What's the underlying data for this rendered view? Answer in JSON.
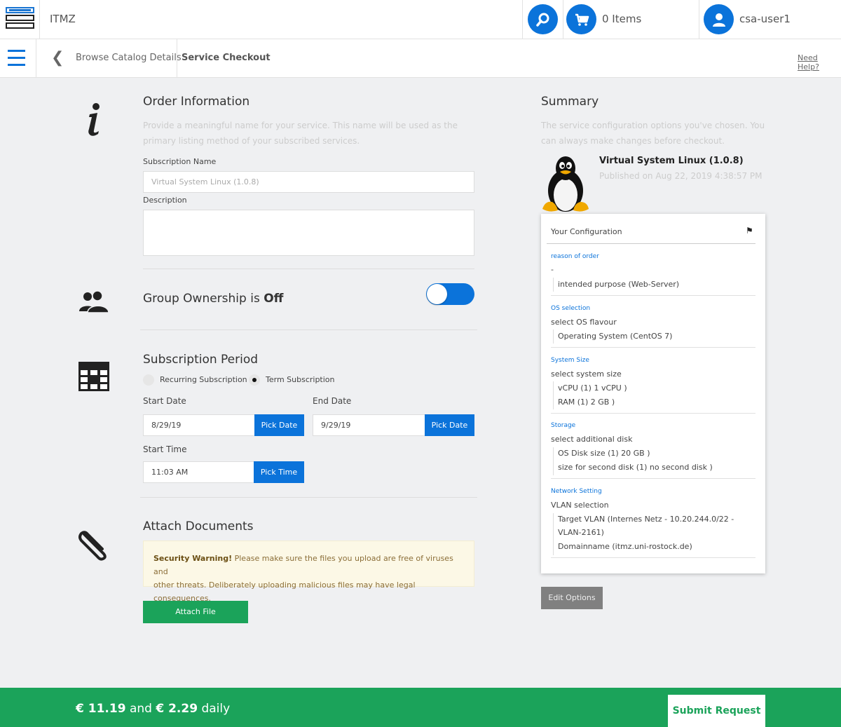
{
  "app": {
    "title": "ITMZ"
  },
  "header": {
    "cart_label": "0 Items",
    "user_name": "csa-user1"
  },
  "nav": {
    "breadcrumb": "Browse Catalog Details",
    "current": "Service Checkout",
    "help": "Need Help?"
  },
  "order": {
    "title": "Order Information",
    "description_line1": "Provide a meaningful name for your service. This name will be used as the",
    "description_line2": "primary listing method of your subscribed services.",
    "subscription_name_label": "Subscription Name",
    "subscription_name_placeholder": "Virtual System Linux (1.0.8)",
    "description_label": "Description"
  },
  "group": {
    "text": "Group Ownership is",
    "state": "Off"
  },
  "subscription": {
    "title": "Subscription Period",
    "options": [
      "Recurring Subscription",
      "Term Subscription"
    ],
    "selected": "Term Subscription",
    "start_date_label": "Start Date",
    "start_date": "8/29/19",
    "end_date_label": "End Date",
    "end_date": "9/29/19",
    "pick_date": "Pick Date",
    "start_time_label": "Start Time",
    "start_time": "11:03 AM",
    "pick_time": "Pick Time"
  },
  "attach": {
    "title": "Attach Documents",
    "warning_bold": "Security Warning!",
    "warning_line1": "Please make sure the files you upload are free of viruses and",
    "warning_line2": "other threats. Deliberately uploading malicious files may have legal consequences.",
    "button": "Attach File"
  },
  "summary": {
    "title": "Summary",
    "description_line1": "The service configuration options you've chosen. You",
    "description_line2": "can always make changes before checkout.",
    "product_name": "Virtual System Linux (1.0.8)",
    "product_published": "Published on Aug 22, 2019 4:38:57 PM",
    "config_title": "Your Configuration",
    "config": {
      "reason_cat": "reason of order",
      "reason_q": "-",
      "reason_a": "intended purpose (Web-Server)",
      "os_cat": "OS selection",
      "os_q": "select OS flavour",
      "os_a": "Operating System (CentOS 7)",
      "size_cat": "System Size",
      "size_q": "select system size",
      "size_a1": "vCPU (1) 1 vCPU )",
      "size_a2": "RAM (1) 2 GB )",
      "storage_cat": "Storage",
      "storage_q": "select additional disk",
      "storage_a1": "OS Disk size (1) 20 GB )",
      "storage_a2": "size for second disk (1) no second disk )",
      "net_cat": "Network Setting",
      "net_q": "VLAN selection",
      "net_a1": "Target VLAN (Internes Netz - 10.20.244.0/22 -",
      "net_a1b": "VLAN-2161)",
      "net_a2": "Domainname (itmz.uni-rostock.de)"
    },
    "edit_button": "Edit Options"
  },
  "footer": {
    "price_once": "€ 11.19",
    "and": "and",
    "price_daily": "€ 2.29",
    "daily": "daily",
    "submit": "Submit Request"
  },
  "colors": {
    "accent": "#0b73da",
    "success": "#1ba35a"
  }
}
